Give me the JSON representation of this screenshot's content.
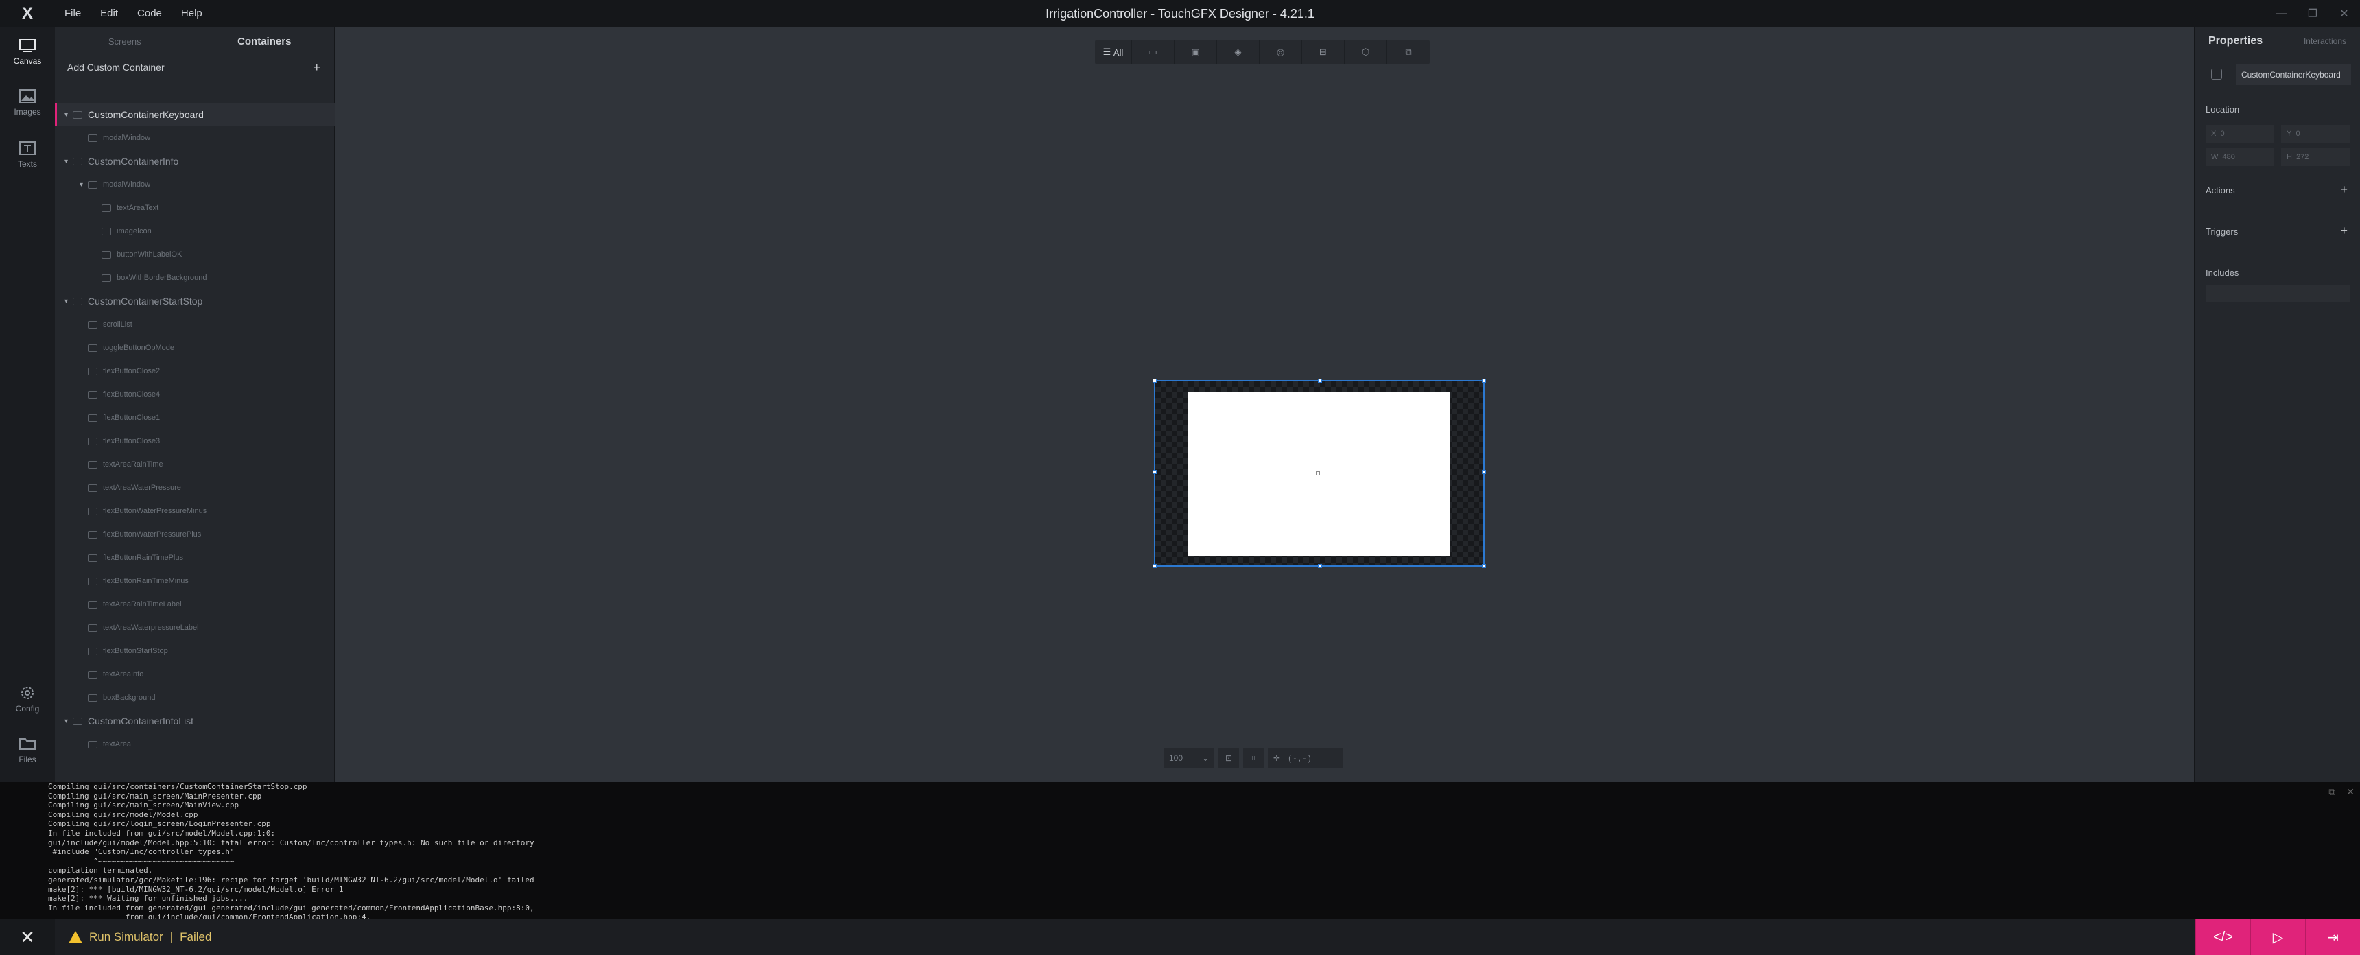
{
  "app": {
    "title": "IrrigationController - TouchGFX Designer - 4.21.1",
    "menu": [
      "File",
      "Edit",
      "Code",
      "Help"
    ]
  },
  "leftbar": {
    "items": [
      {
        "label": "Canvas",
        "icon": "canvas-icon"
      },
      {
        "label": "Images",
        "icon": "images-icon"
      },
      {
        "label": "Texts",
        "icon": "texts-icon"
      },
      {
        "label": "Config",
        "icon": "gear-icon"
      },
      {
        "label": "Files",
        "icon": "folder-icon"
      }
    ]
  },
  "panel": {
    "tabs": [
      "Screens",
      "Containers"
    ],
    "add_label": "Add Custom Container",
    "tree": [
      {
        "label": "CustomContainerKeyboard",
        "kind": "container",
        "level": 0,
        "selected": true
      },
      {
        "label": "modalWindow",
        "kind": "child",
        "level": 1
      },
      {
        "label": "CustomContainerInfo",
        "kind": "container",
        "level": 0
      },
      {
        "label": "modalWindow",
        "kind": "child",
        "level": 1
      },
      {
        "label": "textAreaText",
        "kind": "child",
        "level": 2
      },
      {
        "label": "imageIcon",
        "kind": "child",
        "level": 2
      },
      {
        "label": "buttonWithLabelOK",
        "kind": "child",
        "level": 2
      },
      {
        "label": "boxWithBorderBackground",
        "kind": "child",
        "level": 2
      },
      {
        "label": "CustomContainerStartStop",
        "kind": "container",
        "level": 0
      },
      {
        "label": "scrollList",
        "kind": "child",
        "level": 1
      },
      {
        "label": "toggleButtonOpMode",
        "kind": "child",
        "level": 1
      },
      {
        "label": "flexButtonClose2",
        "kind": "child",
        "level": 1
      },
      {
        "label": "flexButtonClose4",
        "kind": "child",
        "level": 1
      },
      {
        "label": "flexButtonClose1",
        "kind": "child",
        "level": 1
      },
      {
        "label": "flexButtonClose3",
        "kind": "child",
        "level": 1
      },
      {
        "label": "textAreaRainTime",
        "kind": "child",
        "level": 1
      },
      {
        "label": "textAreaWaterPressure",
        "kind": "child",
        "level": 1
      },
      {
        "label": "flexButtonWaterPressureMinus",
        "kind": "child",
        "level": 1
      },
      {
        "label": "flexButtonWaterPressurePlus",
        "kind": "child",
        "level": 1
      },
      {
        "label": "flexButtonRainTimePlus",
        "kind": "child",
        "level": 1
      },
      {
        "label": "flexButtonRainTimeMinus",
        "kind": "child",
        "level": 1
      },
      {
        "label": "textAreaRainTimeLabel",
        "kind": "child",
        "level": 1
      },
      {
        "label": "textAreaWaterpressureLabel",
        "kind": "child",
        "level": 1
      },
      {
        "label": "flexButtonStartStop",
        "kind": "child",
        "level": 1
      },
      {
        "label": "textAreaInfo",
        "kind": "child",
        "level": 1
      },
      {
        "label": "boxBackground",
        "kind": "child",
        "level": 1
      },
      {
        "label": "CustomContainerInfoList",
        "kind": "container",
        "level": 0
      },
      {
        "label": "textArea",
        "kind": "child",
        "level": 1
      }
    ]
  },
  "toolbar": {
    "filter_all": "All",
    "icons": [
      "interaction-icon",
      "image-icon",
      "layers-icon",
      "shapes-icon",
      "button-icon",
      "3d-icon",
      "stack-icon"
    ]
  },
  "zoombar": {
    "zoom": "100",
    "coords": "( - , - )"
  },
  "properties": {
    "tabs": [
      "Properties",
      "Interactions"
    ],
    "name": "CustomContainerKeyboard",
    "location_label": "Location",
    "x": "0",
    "y": "0",
    "w": "480",
    "h": "272",
    "actions_label": "Actions",
    "triggers_label": "Triggers",
    "includes_label": "Includes"
  },
  "console": {
    "text": "Compiling gui/src/containers/CustomContainerStartStop.cpp\nCompiling gui/src/main_screen/MainPresenter.cpp\nCompiling gui/src/main_screen/MainView.cpp\nCompiling gui/src/model/Model.cpp\nCompiling gui/src/login_screen/LoginPresenter.cpp\nIn file included from gui/src/model/Model.cpp:1:0:\ngui/include/gui/model/Model.hpp:5:10: fatal error: Custom/Inc/controller_types.h: No such file or directory\n #include \"Custom/Inc/controller_types.h\"\n          ^~~~~~~~~~~~~~~~~~~~~~~~~~~~~~~\ncompilation terminated.\ngenerated/simulator/gcc/Makefile:196: recipe for target 'build/MINGW32_NT-6.2/gui/src/model/Model.o' failed\nmake[2]: *** [build/MINGW32_NT-6.2/gui/src/model/Model.o] Error 1\nmake[2]: *** Waiting for unfinished jobs....\nIn file included from generated/gui_generated/include/gui_generated/common/FrontendApplicationBase.hpp:8:0,\n                 from gui/include/gui/common/FrontendApplication.hpp:4,"
  },
  "status": {
    "action": "Run Simulator",
    "separator": "|",
    "result": "Failed",
    "accent": "#e0237a"
  }
}
